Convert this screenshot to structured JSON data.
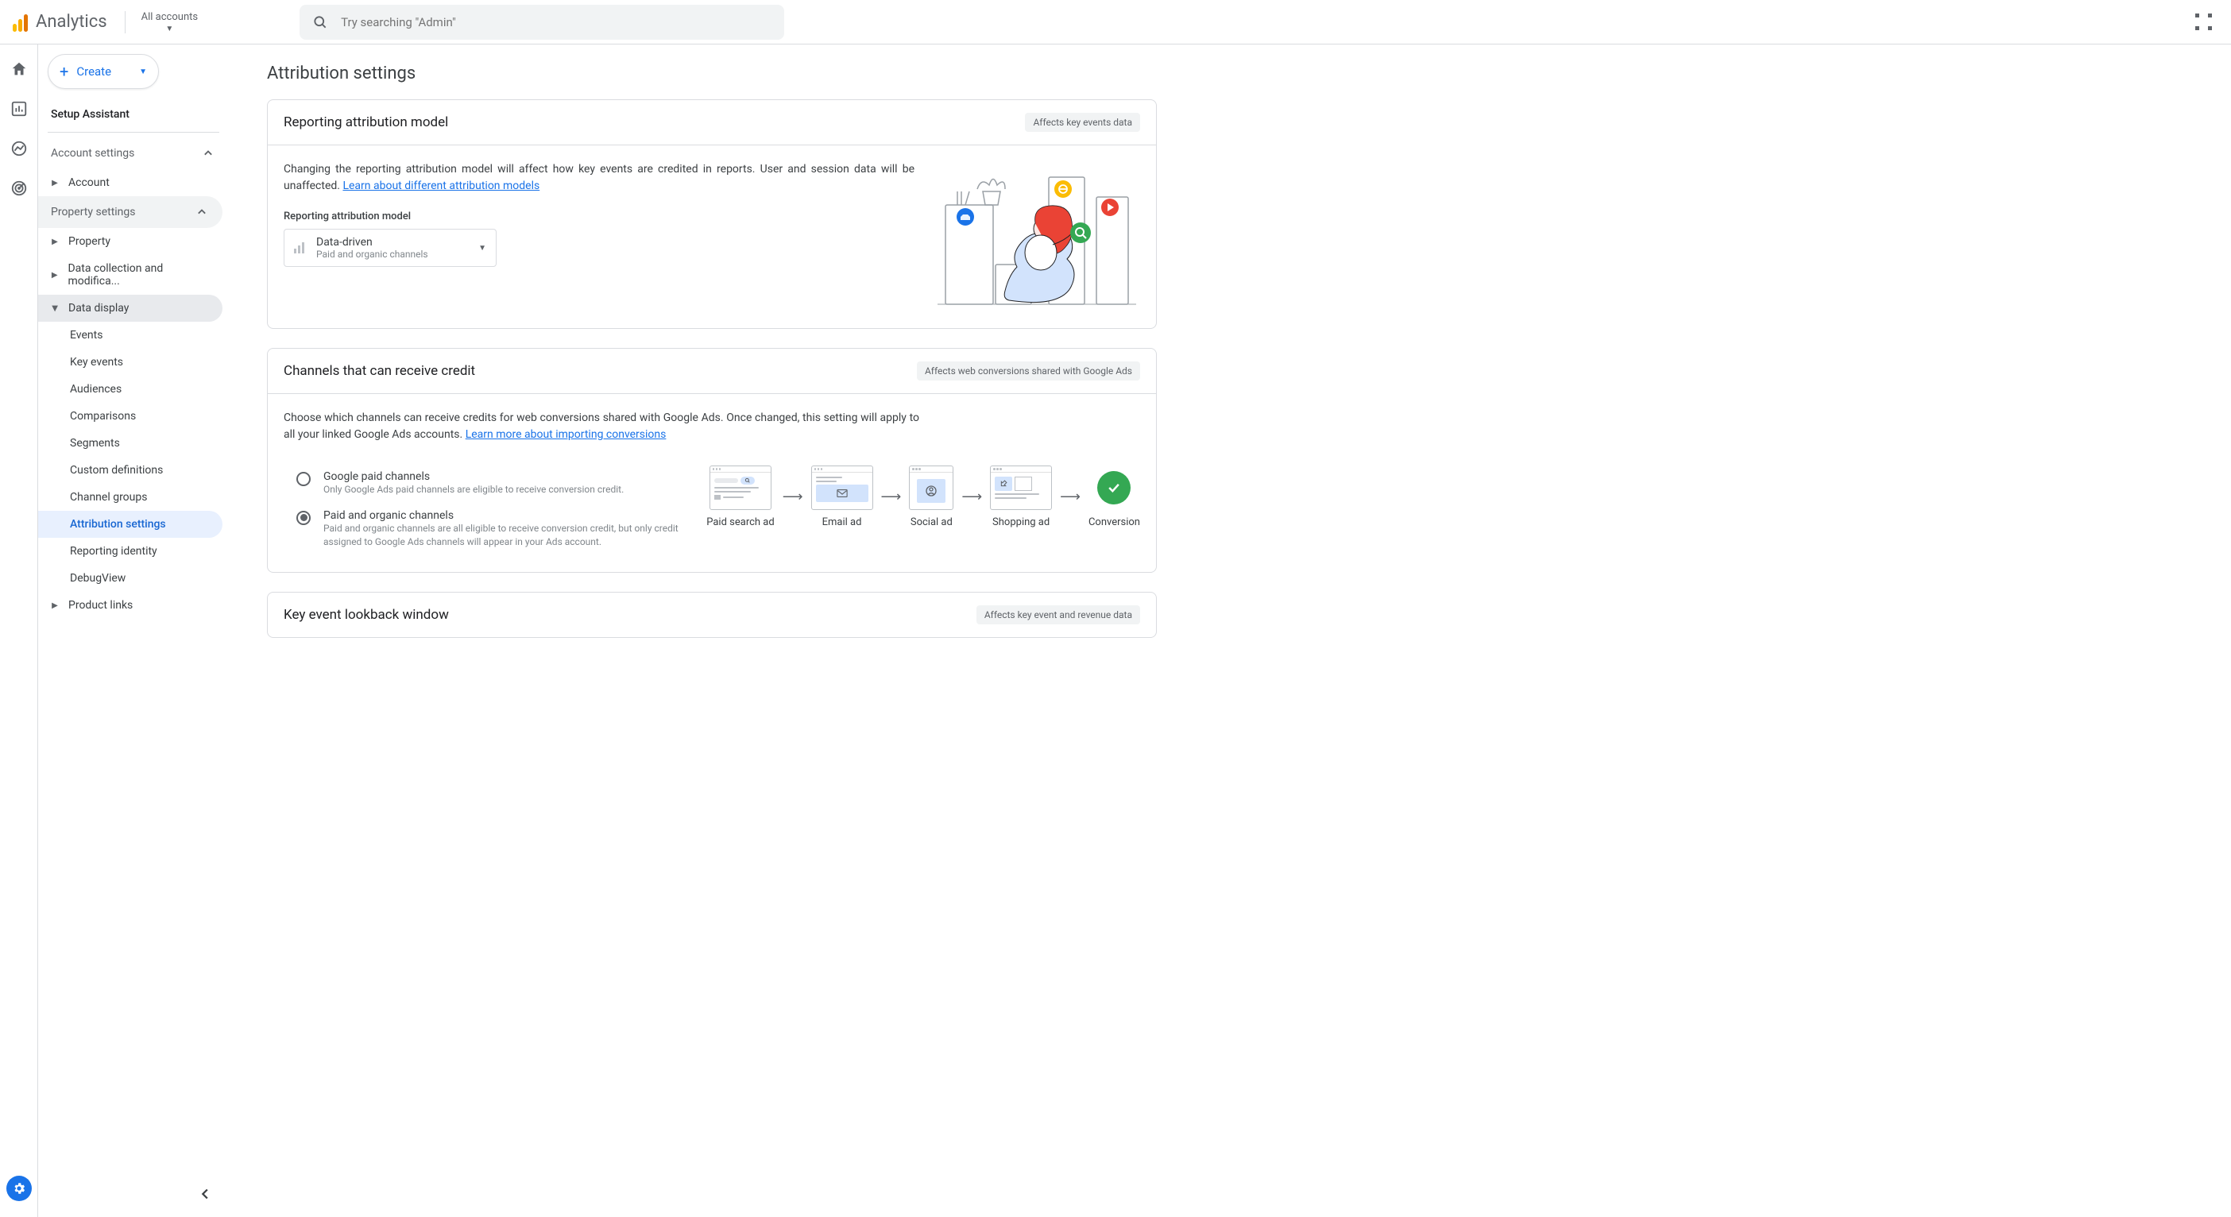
{
  "brand": "Analytics",
  "accountSelector": {
    "label": "All accounts"
  },
  "search": {
    "placeholder": "Try searching \"Admin\""
  },
  "createButton": "Create",
  "sidebar": {
    "setupAssistant": "Setup Assistant",
    "accountSettings": "Account settings",
    "account": "Account",
    "propertySettings": "Property settings",
    "property": "Property",
    "dataCollection": "Data collection and modifica...",
    "dataDisplay": "Data display",
    "subItems": {
      "events": "Events",
      "keyEvents": "Key events",
      "audiences": "Audiences",
      "comparisons": "Comparisons",
      "segments": "Segments",
      "customDefinitions": "Custom definitions",
      "channelGroups": "Channel groups",
      "attributionSettings": "Attribution settings",
      "reportingIdentity": "Reporting identity",
      "debugView": "DebugView"
    },
    "productLinks": "Product links"
  },
  "page": {
    "title": "Attribution settings",
    "card1": {
      "title": "Reporting attribution model",
      "badge": "Affects key events data",
      "desc1": "Changing the reporting attribution model will affect how key events are credited in reports. User and session data will be unaffected. ",
      "link1": "Learn about different attribution models",
      "fieldLabel": "Reporting attribution model",
      "ddMain": "Data-driven",
      "ddSub": "Paid and organic channels"
    },
    "card2": {
      "title": "Channels that can receive credit",
      "badge": "Affects web conversions shared with Google Ads",
      "desc1": "Choose which channels can receive credits for web conversions shared with Google Ads. Once changed, this setting will apply to all your linked Google Ads accounts. ",
      "link1": "Learn more about importing conversions",
      "opt1t": "Google paid channels",
      "opt1s": "Only Google Ads paid channels are eligible to receive conversion credit.",
      "opt2t": "Paid and organic channels",
      "opt2s": "Paid and organic channels are all eligible to receive conversion credit, but only credit assigned to Google Ads channels will appear in your Ads account.",
      "flow": {
        "s1": "Paid search ad",
        "s2": "Email ad",
        "s3": "Social ad",
        "s4": "Shopping ad",
        "s5": "Conversion"
      }
    },
    "card3": {
      "title": "Key event lookback window",
      "badge": "Affects key event and revenue data"
    }
  }
}
